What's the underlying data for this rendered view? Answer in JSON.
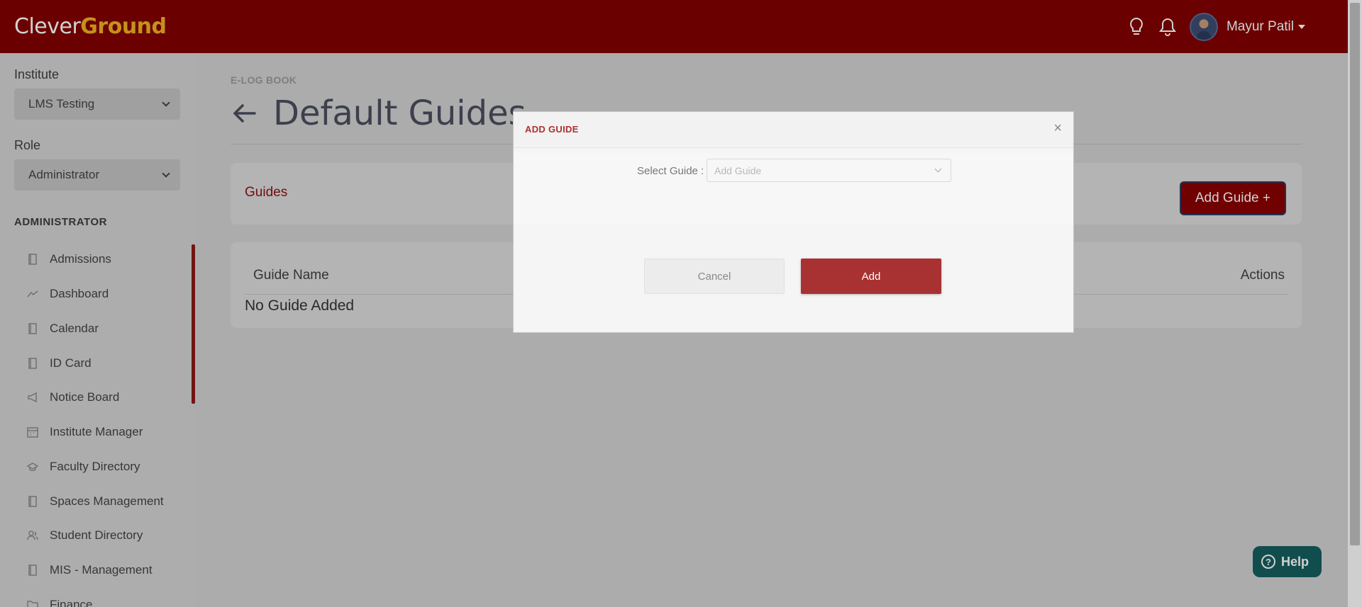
{
  "app": {
    "logo_part1": "Clever",
    "logo_part2": "Ground",
    "brand_color": "#830000",
    "accent_color": "#f0b323"
  },
  "header": {
    "user_name": "Mayur Patil",
    "icons": [
      "lightbulb-icon",
      "bell-icon"
    ]
  },
  "sidebar": {
    "institute_label": "Institute",
    "institute_value": "LMS Testing",
    "role_label": "Role",
    "role_value": "Administrator",
    "section_title": "ADMINISTRATOR",
    "items": [
      {
        "label": "Admissions",
        "icon": "book-icon"
      },
      {
        "label": "Dashboard",
        "icon": "line-chart-icon"
      },
      {
        "label": "Calendar",
        "icon": "book-icon"
      },
      {
        "label": "ID Card",
        "icon": "book-icon"
      },
      {
        "label": "Notice Board",
        "icon": "megaphone-icon"
      },
      {
        "label": "Institute Manager",
        "icon": "calendar-icon"
      },
      {
        "label": "Faculty Directory",
        "icon": "graduation-cap-icon"
      },
      {
        "label": "Spaces Management",
        "icon": "book-icon"
      },
      {
        "label": "Student Directory",
        "icon": "users-icon"
      },
      {
        "label": "MIS - Management",
        "icon": "book-icon"
      },
      {
        "label": "Finance",
        "icon": "folder-icon"
      }
    ]
  },
  "main": {
    "breadcrumb": "E-LOG BOOK",
    "title": "Default Guides",
    "guides_heading": "Guides",
    "add_guide_button": "Add Guide +",
    "table": {
      "columns": [
        "Guide Name",
        "Actions"
      ],
      "empty_message": "No Guide Added"
    }
  },
  "help": {
    "label": "Help"
  },
  "modal": {
    "title": "ADD GUIDE",
    "close_symbol": "×",
    "field_label": "Select Guide :",
    "field_placeholder": "Add Guide",
    "cancel_label": "Cancel",
    "add_label": "Add"
  }
}
